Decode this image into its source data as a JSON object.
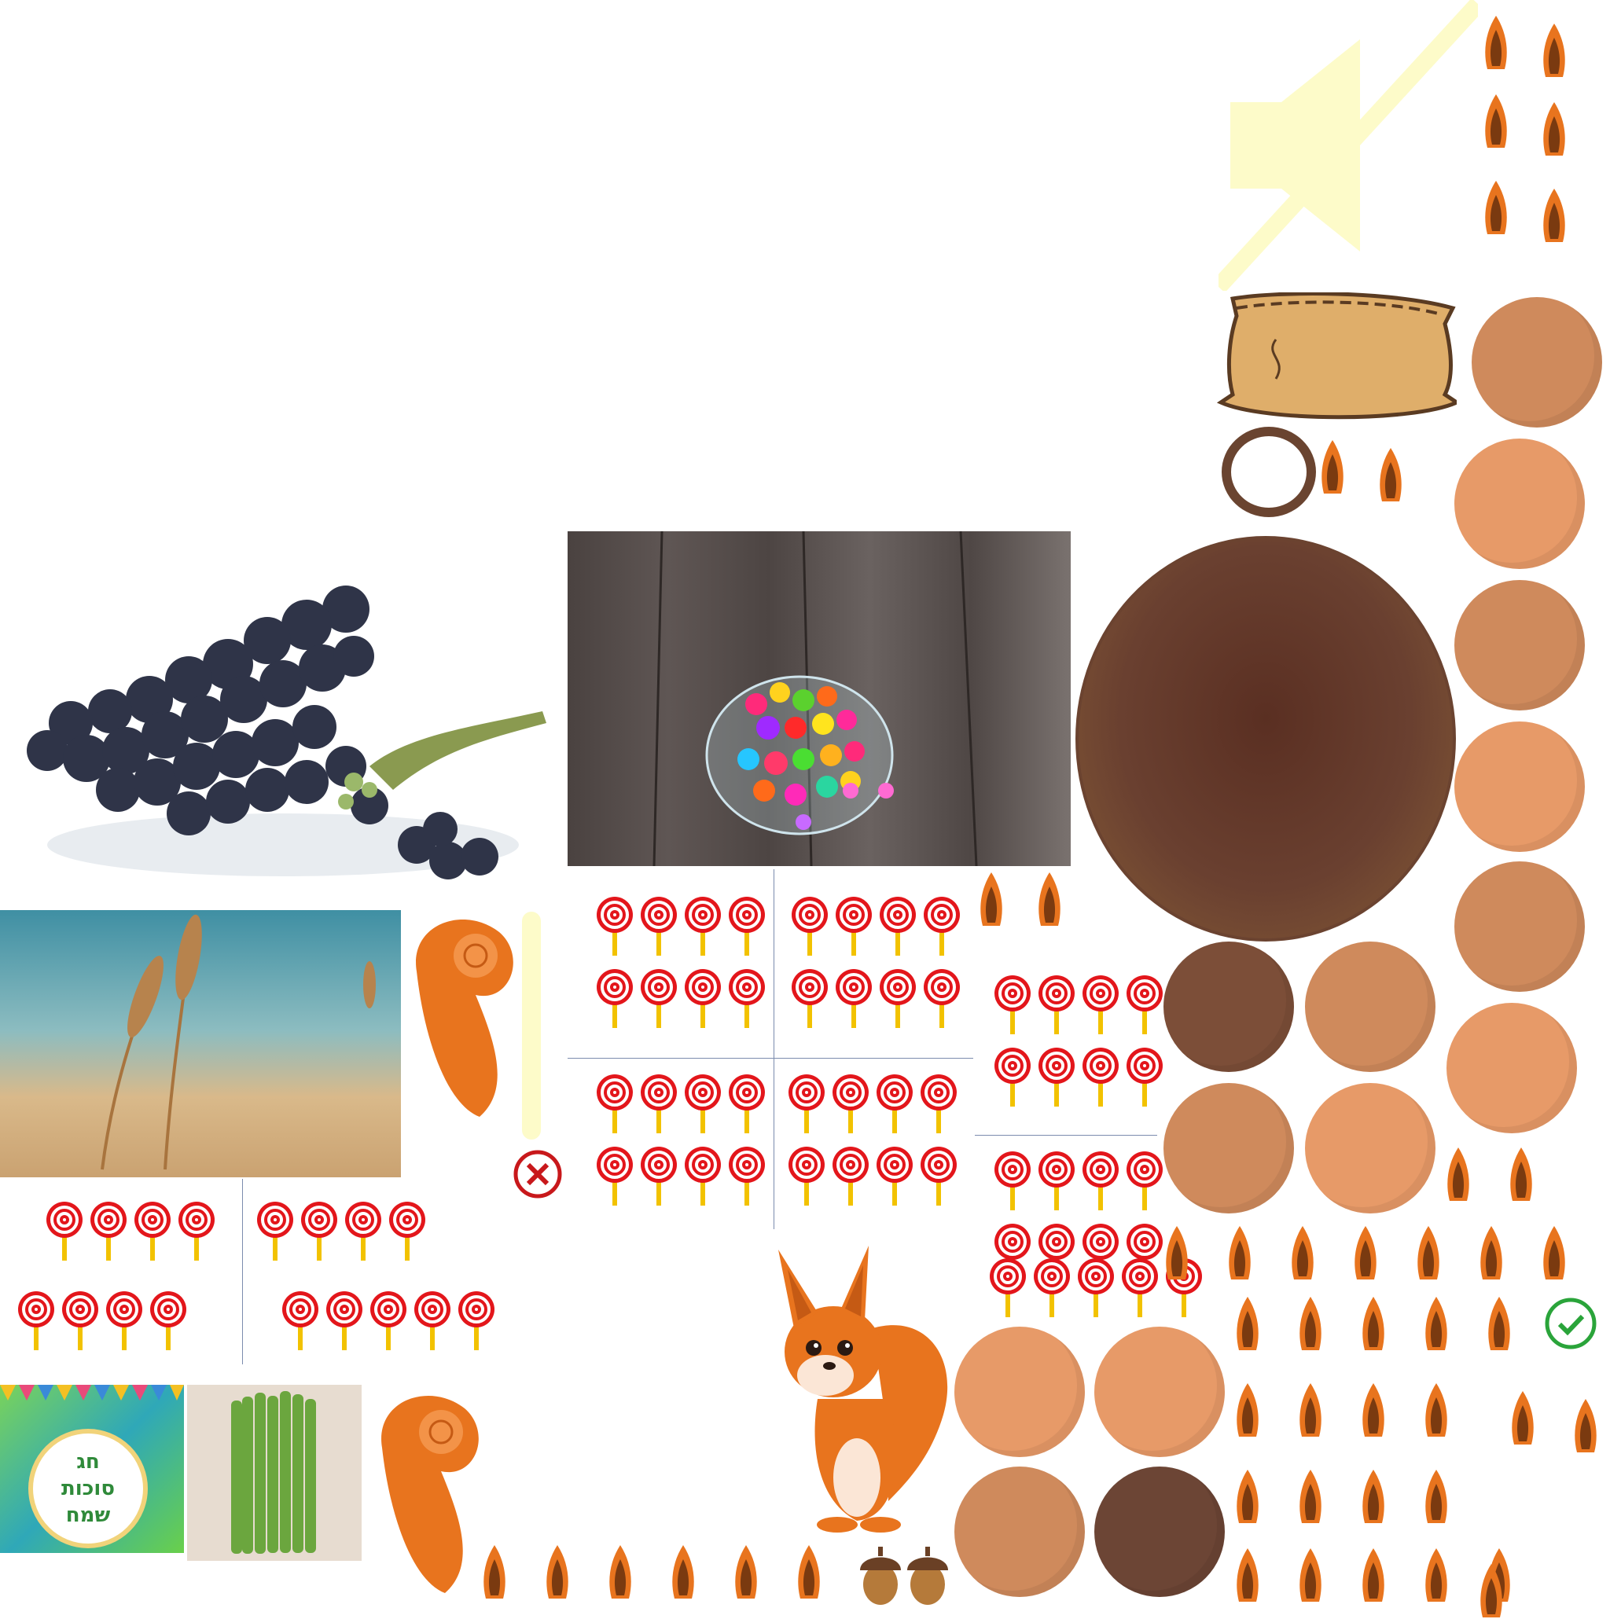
{
  "banner": {
    "line1": "חג",
    "line2": "סוכות",
    "line3": "שמח"
  },
  "images": {
    "grapes": "grapes-photo",
    "candy_jar": "candy-jar-photo",
    "wheat": "wheat-field-photo",
    "willow": "willow-branches-photo"
  },
  "icons": {
    "mute": "speaker-muted-icon",
    "close": "close-circle-icon",
    "check": "check-circle-icon"
  },
  "colors": {
    "lollipop_red": "#e3161b",
    "lollipop_stick": "#f2c200",
    "squirrel_orange": "#e8741e",
    "nut_light": "#e79a68",
    "nut_mid": "#cf8a5c",
    "nut_dark": "#7c4e38",
    "bowl_brown": "#5b3a2a",
    "check_green": "#2aa43a",
    "close_red": "#c8181b"
  },
  "lollipop_groups": [
    {
      "rows": [
        4,
        4
      ]
    },
    {
      "rows": [
        4,
        4
      ]
    },
    {
      "rows": [
        4,
        4
      ]
    },
    {
      "rows": [
        4,
        4
      ]
    },
    {
      "rows": [
        4,
        4
      ]
    },
    {
      "rows": [
        4,
        4
      ]
    },
    {
      "rows": [
        4,
        4
      ]
    },
    {
      "rows": [
        4,
        5
      ]
    },
    {
      "rows": [
        5,
        4
      ]
    }
  ]
}
